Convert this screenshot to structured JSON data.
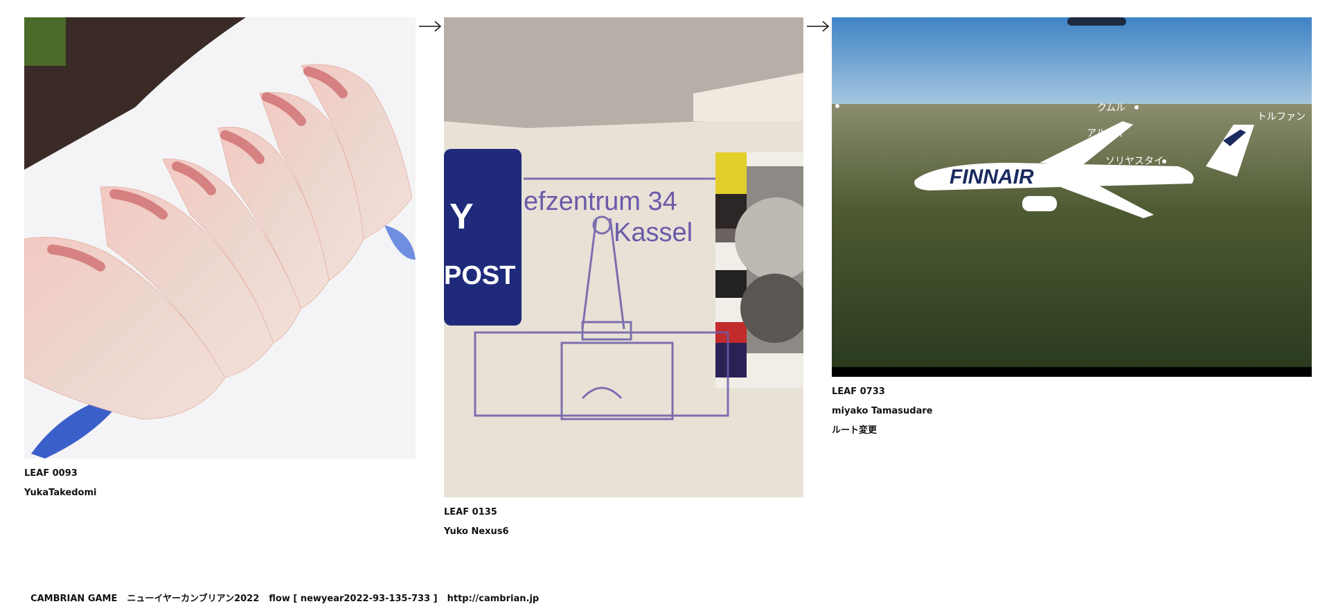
{
  "leaves": [
    {
      "id": "LEAF 0093",
      "author": "YukaTakedomi",
      "caption": "",
      "image_alt": "sliced yellowtail sashimi on a white plate"
    },
    {
      "id": "LEAF 0135",
      "author": "Yuko Nexus6",
      "caption": "",
      "image_alt": "envelope with Kassel postmark",
      "image_text": {
        "postmark_line1": "efzentrum 34",
        "postmark_line2": "Kassel",
        "post_logo": "POST",
        "post_letter": "Y"
      }
    },
    {
      "id": "LEAF 0733",
      "author": "miyako Tamasudare",
      "caption": "ルート変更",
      "image_alt": "in-flight map with Finnair plane over terrain",
      "image_text": {
        "airline": "FINNAIR",
        "place1": "クムル",
        "place2": "トルファン",
        "place3": "アルタイ",
        "place4": "ソリヤスタイ"
      }
    }
  ],
  "arrow_icon": "right-arrow-icon",
  "footer": {
    "brand": "CAMBRIAN GAME",
    "title": "ニューイヤーカンブリアン2022",
    "flow": "flow [ newyear2022-93-135-733 ]",
    "url": "http://cambrian.jp"
  },
  "colors": {
    "plate_blue": "#3b5fc8",
    "post_blue": "#1f2b7a",
    "stamp_purple": "#6a5aa8",
    "sky": "#5f9fd6",
    "finnair_blue": "#1b2a5e"
  }
}
